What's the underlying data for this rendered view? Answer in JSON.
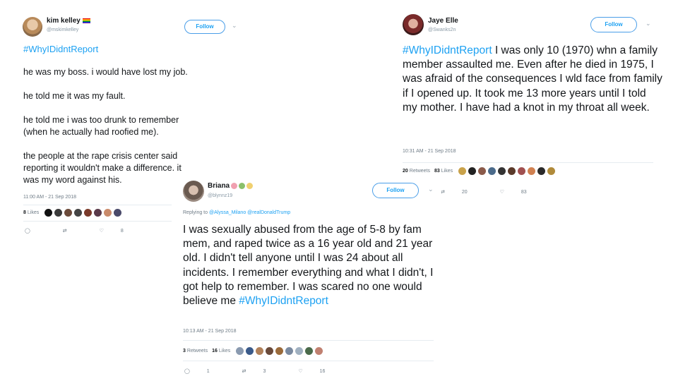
{
  "tweets": {
    "t1": {
      "name": "kim kelley",
      "handle": "@mskimkelley",
      "follow_label": "Follow",
      "hashtag": "#WhyIDidntReport",
      "text": "he was my boss. i would have lost my job.\n\nhe told me it was my fault.\n\nhe told me i was too drunk to remember\n(when he actually had roofied me).\n\nthe people at the rape crisis center said\nreporting it wouldn't make a difference. it\nwas my word against his.",
      "timestamp": "11:00 AM - 21 Sep 2018",
      "likes_count": "8",
      "likes_label": "Likes",
      "reply_count": "",
      "retweet_count": "",
      "like_count": "8",
      "liker_colors": [
        "#111111",
        "#3a3a3a",
        "#6b4a3a",
        "#444444",
        "#7a3a2a",
        "#5a3a4a",
        "#c98a6a",
        "#4a4a6a"
      ]
    },
    "t2": {
      "name": "Jaye Elle",
      "handle": "@Swanks2n",
      "follow_label": "Follow",
      "hashtag": "#WhyIDidntReport",
      "text": " I was only 10 (1970) whn a family member assaulted me. Even after he died in 1975, I was afraid of the consequences I wld face from family if I opened up. It took me 13 more years until I told my mother.  I have had a knot in my throat all week.",
      "timestamp": "10:31 AM - 21 Sep 2018",
      "retweets_count": "20",
      "retweets_label": "Retweets",
      "likes_count": "83",
      "likes_label": "Likes",
      "retweet_count": "20",
      "like_count": "83",
      "liker_colors": [
        "#c9a24a",
        "#222222",
        "#8a5a4a",
        "#4a6a8a",
        "#333333",
        "#5a3a2a",
        "#a05050",
        "#d08050",
        "#2a2a2a",
        "#b08a3a"
      ]
    },
    "t3": {
      "name": "Briana",
      "handle": "@blynnz19",
      "follow_label": "Follow",
      "reply_prefix": "Replying to",
      "reply_users": "@Alyssa_Milano @realDonaldTrump",
      "text": "I was sexually abused from the age of 5-8 by fam mem, and raped twice as a 16 year old and 21 year old. I didn't tell anyone until I was 24 about all incidents. I remember everything and what I didn't, I got help to remember. I was scared no one would believe me ",
      "hashtag": "#WhyIDidntReport",
      "timestamp": "10:13 AM - 21 Sep 2018",
      "retweets_count": "3",
      "retweets_label": "Retweets",
      "likes_count": "16",
      "likes_label": "Likes",
      "reply_count": "1",
      "retweet_count": "3",
      "like_count": "16",
      "liker_colors": [
        "#8a9ab0",
        "#3a5a8a",
        "#b0805a",
        "#6a4a3a",
        "#9a6a3a",
        "#7a8aa0",
        "#a0b0c0",
        "#4a6a4a",
        "#c08070"
      ]
    }
  },
  "icons": {
    "reply": "reply-icon",
    "retweet": "retweet-icon",
    "like": "heart-icon",
    "chevron": "chevron-down-icon"
  },
  "colors": {
    "link": "#1da1f2",
    "muted": "#6e7b86",
    "text": "#14171a"
  }
}
